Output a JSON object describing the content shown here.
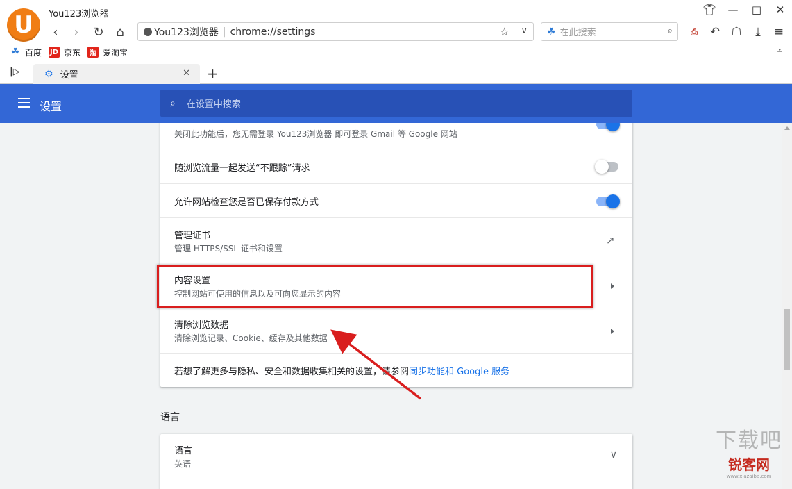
{
  "window": {
    "title": "You123浏览器",
    "controls": [
      "shirt-icon",
      "minimize-icon",
      "maximize-icon",
      "close-icon"
    ]
  },
  "toolbar": {
    "app_name": "You123浏览器",
    "url": "chrome://settings",
    "search_placeholder": "在此搜索"
  },
  "bookmarks": [
    {
      "label": "百度",
      "icon": "baidu-paw-icon",
      "color": "#2e7bd6"
    },
    {
      "label": "京东",
      "icon": "jd-icon",
      "color": "#e1251b",
      "glyph": "JD"
    },
    {
      "label": "爱淘宝",
      "icon": "taobao-icon",
      "color": "#e1251b",
      "glyph": "淘"
    }
  ],
  "tab": {
    "label": "设置"
  },
  "settings": {
    "title": "设置",
    "search_placeholder": "在设置中搜索",
    "header_color": "#3367d6",
    "rows": [
      {
        "title": "",
        "subtitle": "关闭此功能后，您无需登录 You123浏览器 即可登录 Gmail 等 Google 网站",
        "control": "toggle",
        "on": true
      },
      {
        "title": "随浏览流量一起发送“不跟踪”请求",
        "control": "toggle",
        "on": false
      },
      {
        "title": "允许网站检查您是否已保存付款方式",
        "control": "toggle",
        "on": true
      },
      {
        "title": "管理证书",
        "subtitle": "管理 HTTPS/SSL 证书和设置",
        "control": "external-link"
      },
      {
        "title": "内容设置",
        "subtitle": "控制网站可使用的信息以及可向您显示的内容",
        "control": "arrow"
      },
      {
        "title": "清除浏览数据",
        "subtitle": "清除浏览记录、Cookie、缓存及其他数据",
        "control": "arrow"
      }
    ],
    "footer_text": "若想了解更多与隐私、安全和数据收集相关的设置，请参阅",
    "footer_link": "同步功能和 Google 服务",
    "language_section": "语言",
    "language_row": {
      "title": "语言",
      "subtitle": "英语"
    }
  },
  "annotation": {
    "highlight_color": "#d91e1e"
  },
  "watermark": {
    "line1": "下载吧",
    "line2": "锐客网",
    "line3": "www.xiazaiba.com"
  }
}
